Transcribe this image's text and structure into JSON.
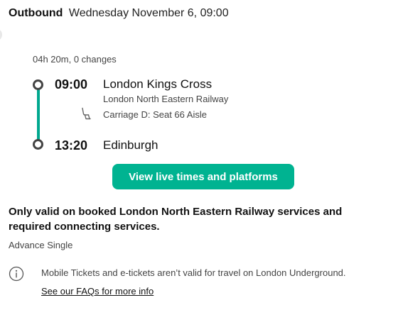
{
  "header": {
    "direction": "Outbound",
    "date_time": "Wednesday November 6, 09:00"
  },
  "journey": {
    "summary": "04h 20m, 0 changes",
    "departure": {
      "time": "09:00",
      "station": "London Kings Cross",
      "operator": "London North Eastern Railway",
      "seat": "Carriage D: Seat 66 Aisle"
    },
    "arrival": {
      "time": "13:20",
      "station": "Edinburgh"
    }
  },
  "actions": {
    "live_times_label": "View live times and platforms"
  },
  "ticket": {
    "validity": "Only valid on booked London North Eastern Railway services and required connecting services.",
    "type": "Advance Single"
  },
  "info": {
    "message": "Mobile Tickets and e-tickets aren’t valid for travel on London Underground.",
    "faq_link": "See our FAQs for more info"
  },
  "colors": {
    "accent": "#00b391",
    "rail": "#00a88f"
  },
  "icons": {
    "seat": "seat-icon",
    "info": "info-icon"
  }
}
